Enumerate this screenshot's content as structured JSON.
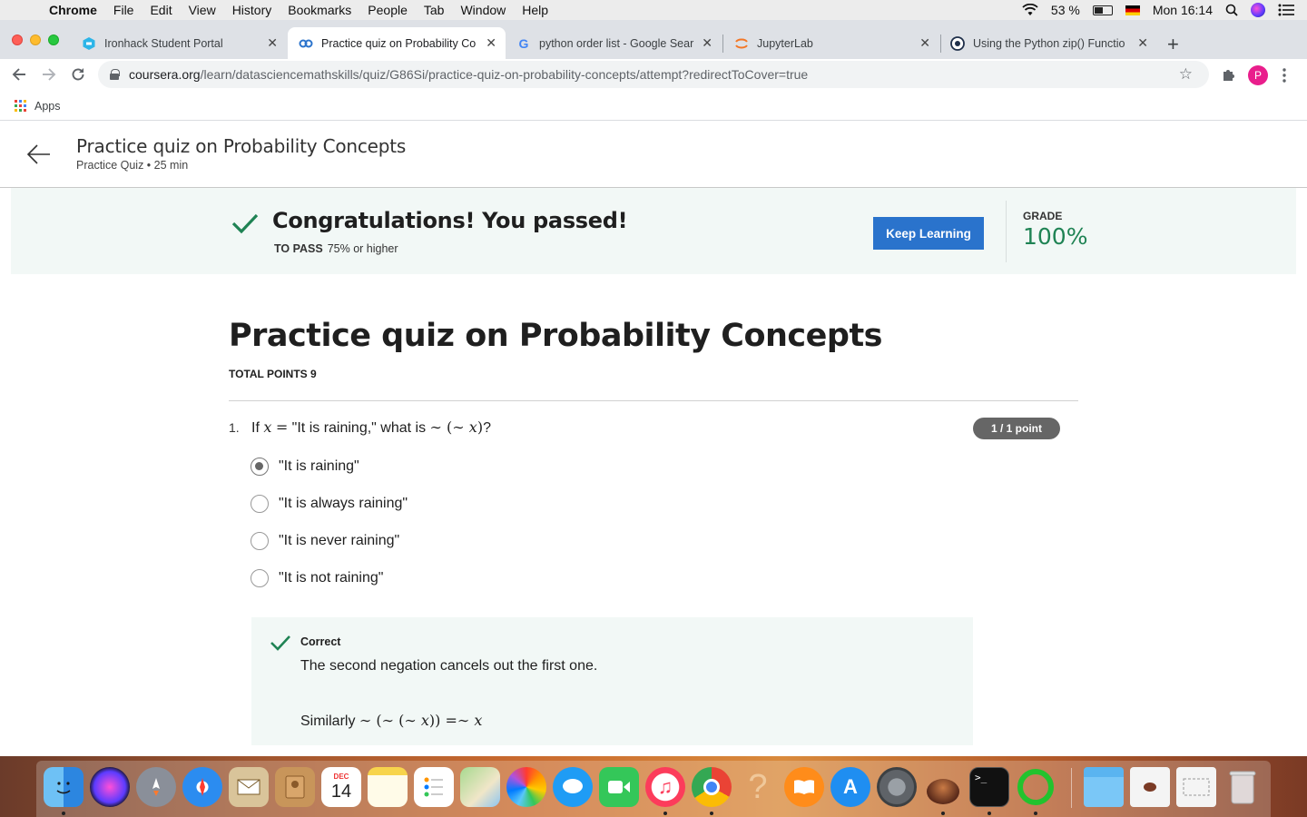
{
  "menubar": {
    "app": "Chrome",
    "items": [
      "File",
      "Edit",
      "View",
      "History",
      "Bookmarks",
      "People",
      "Tab",
      "Window",
      "Help"
    ],
    "battery": "53 %",
    "clock": "Mon 16:14"
  },
  "tabs": [
    {
      "title": "Ironhack Student Portal",
      "icon": "ironhack-icon",
      "active": false
    },
    {
      "title": "Practice quiz on Probability Co",
      "icon": "coursera-icon",
      "active": true
    },
    {
      "title": "python order list - Google Sear",
      "icon": "google-icon",
      "active": false
    },
    {
      "title": "JupyterLab",
      "icon": "jupyter-icon",
      "active": false
    },
    {
      "title": "Using the Python zip() Functio",
      "icon": "realpython-icon",
      "active": false
    }
  ],
  "address_bar": {
    "host": "coursera.org",
    "path": "/learn/datasciencemathskills/quiz/G86Si/practice-quiz-on-probability-concepts/attempt?redirectToCover=true"
  },
  "profile_initial": "P",
  "bookmarks": {
    "apps_label": "Apps"
  },
  "header": {
    "title": "Practice quiz on Probability Concepts",
    "subtitle": "Practice Quiz • 25 min"
  },
  "banner": {
    "message": "Congratulations! You passed!",
    "to_pass_label": "TO PASS",
    "to_pass_value": "75% or higher",
    "keep_learning": "Keep Learning",
    "grade_label": "GRADE",
    "grade_value": "100%",
    "success_color": "#1f8354",
    "button_color": "#2a73cc"
  },
  "quiz": {
    "title": "Practice quiz on Probability Concepts",
    "total_points": "TOTAL POINTS 9",
    "question": {
      "number": "1.",
      "points": "1 / 1 point",
      "options": [
        "\"It is raining\"",
        "\"It is always raining\"",
        "\"It is never raining\"",
        "\"It is not raining\""
      ],
      "selected_index": 0,
      "feedback_label": "Correct",
      "feedback_text": "The second negation cancels out the first one."
    }
  },
  "dock": {
    "apps": [
      "finder-icon",
      "siri-icon",
      "launchpad-icon",
      "safari-icon",
      "mail-icon",
      "contacts-icon",
      "calendar-icon",
      "notes-icon",
      "reminders-icon",
      "maps-icon",
      "photos-icon",
      "messages-icon",
      "facetime-icon",
      "music-icon",
      "chrome-icon",
      "help-icon",
      "books-icon",
      "app-store-icon",
      "system-preferences-icon",
      "mojave-installer-icon",
      "terminal-icon",
      "activity-ring-icon",
      "folder-icon",
      "preview-icon",
      "screenshot-icon",
      "trash-icon"
    ],
    "calendar_month": "DEC",
    "calendar_day": "14"
  }
}
